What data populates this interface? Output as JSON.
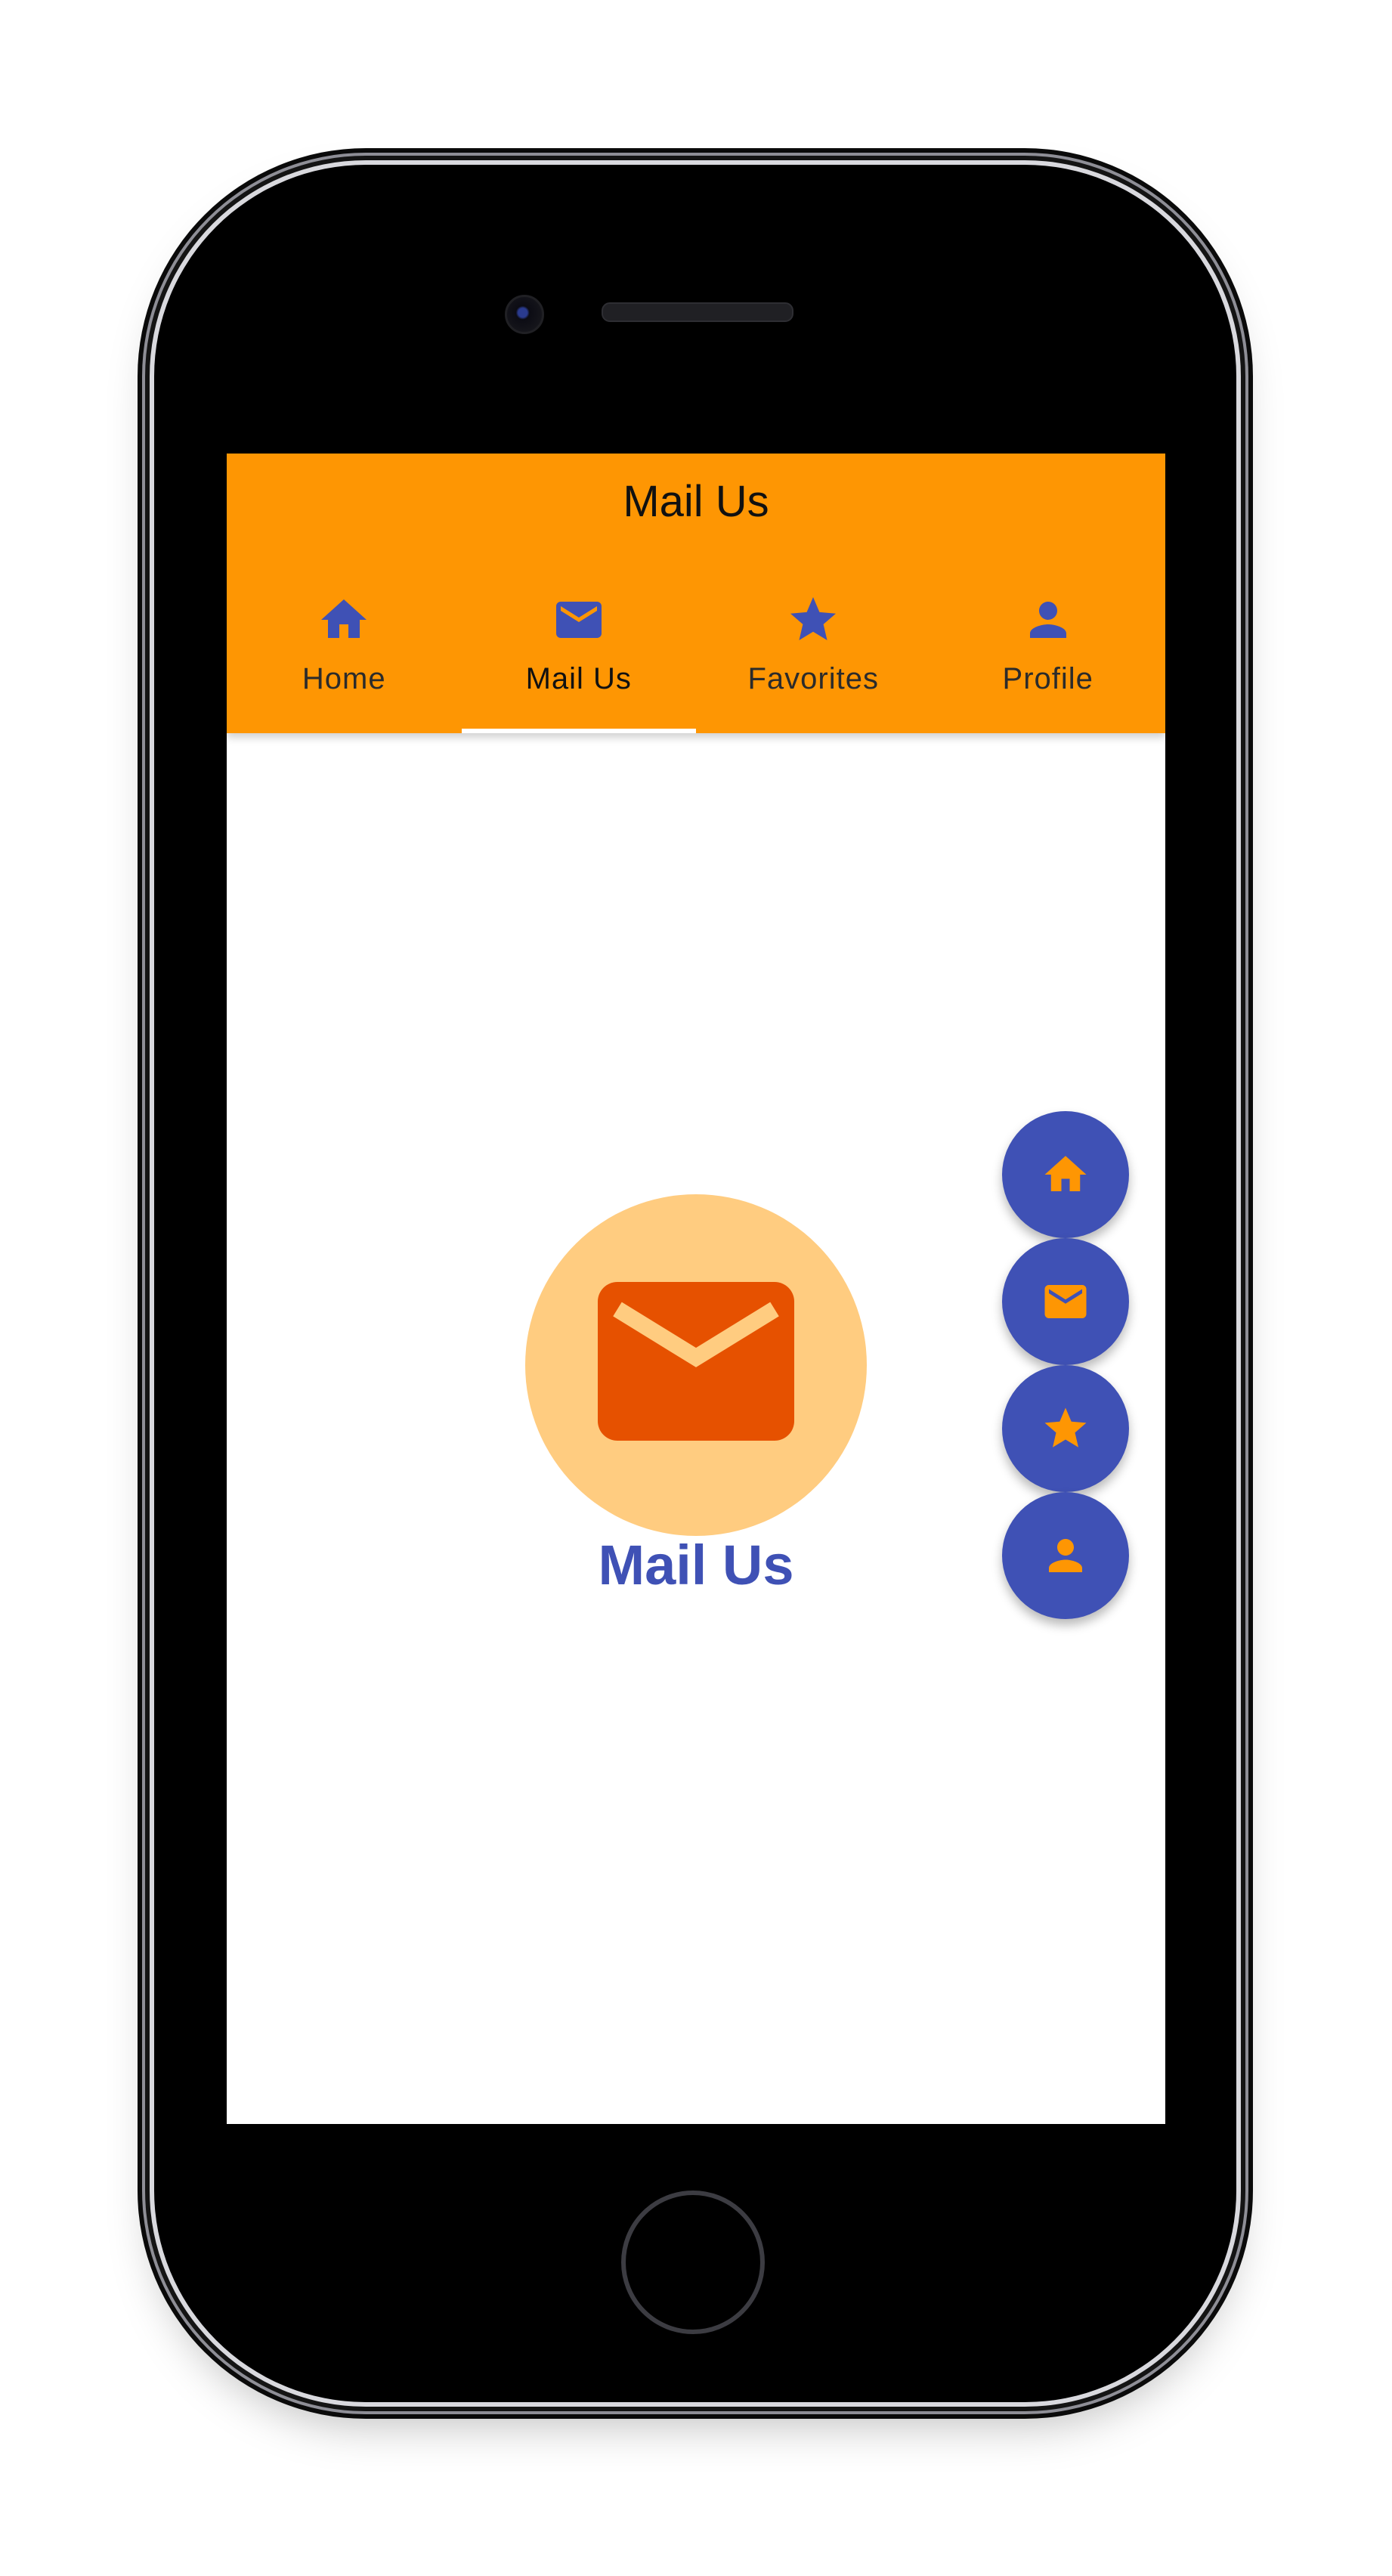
{
  "colors": {
    "appbar": "#fe9603",
    "accent": "#3f51b5",
    "hero_circle": "#ffcc80",
    "hero_icon": "#e65100",
    "fab_icon": "#fe9603"
  },
  "appbar": {
    "title": "Mail Us"
  },
  "tabs": [
    {
      "label": "Home",
      "icon": "home-icon"
    },
    {
      "label": "Mail Us",
      "icon": "mail-icon",
      "active": true
    },
    {
      "label": "Favorites",
      "icon": "star-icon"
    },
    {
      "label": "Profile",
      "icon": "person-icon"
    }
  ],
  "content": {
    "label": "Mail Us",
    "icon": "mail-icon"
  },
  "fabs": [
    {
      "icon": "home-icon"
    },
    {
      "icon": "mail-icon"
    },
    {
      "icon": "star-icon"
    },
    {
      "icon": "person-icon"
    }
  ]
}
